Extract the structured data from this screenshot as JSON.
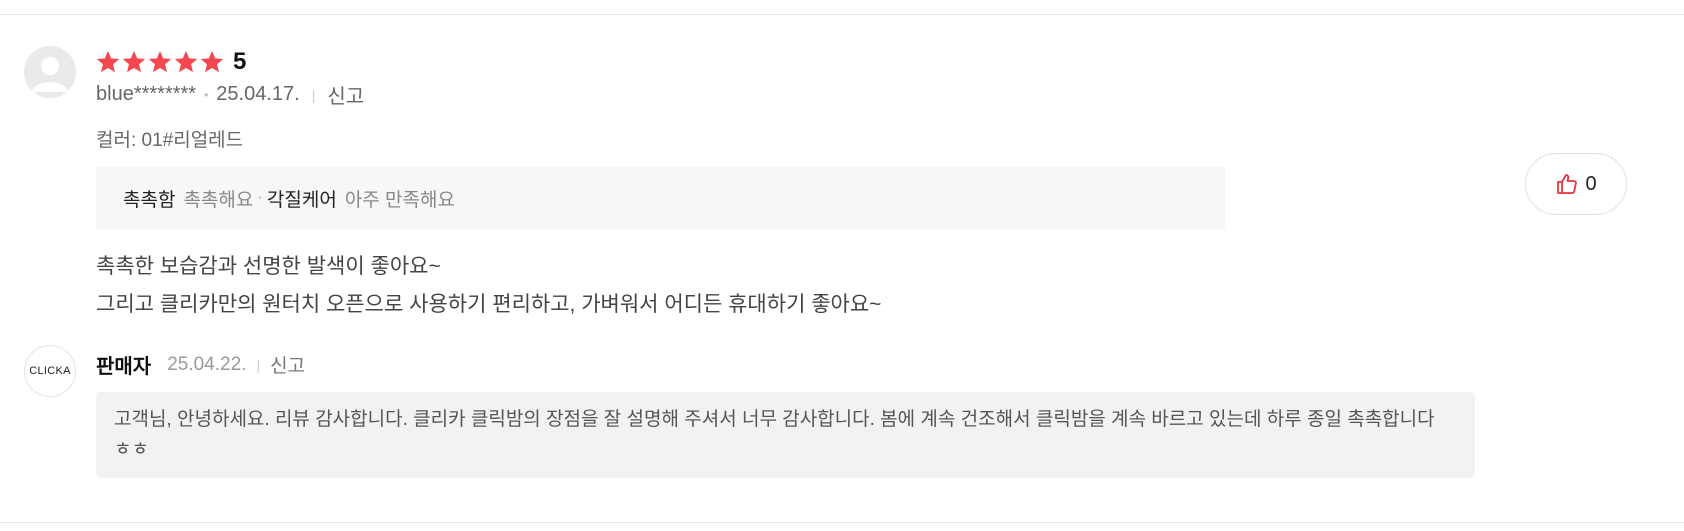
{
  "review": {
    "rating_value": "5",
    "star_count": 5,
    "user": "blue********",
    "date": "25.04.17.",
    "report_label": "신고",
    "option": "컬러: 01#리얼레드",
    "attributes": [
      {
        "key": "촉촉함",
        "value": "촉촉해요"
      },
      {
        "key": "각질케어",
        "value": "아주 만족해요"
      }
    ],
    "body_lines": [
      "촉촉한 보습감과 선명한 발색이 좋아요~",
      "그리고 클리카만의 원터치 오픈으로 사용하기 편리하고, 가벼워서 어디든 휴대하기 좋아요~"
    ],
    "like_count": "0"
  },
  "seller_reply": {
    "logo_text": "CLICKA",
    "name": "판매자",
    "date": "25.04.22.",
    "report_label": "신고",
    "text": "고객님, 안녕하세요. 리뷰 감사합니다.  클리카 클릭밤의 장점을  잘 설명해 주셔서 너무 감사합니다.  봄에 계속 건조해서 클릭밤을 계속 바르고 있는데 하루 종일 촉촉합니다 ㅎㅎ"
  },
  "colors": {
    "star": "#f5474f",
    "like_icon": "#e8343c"
  }
}
